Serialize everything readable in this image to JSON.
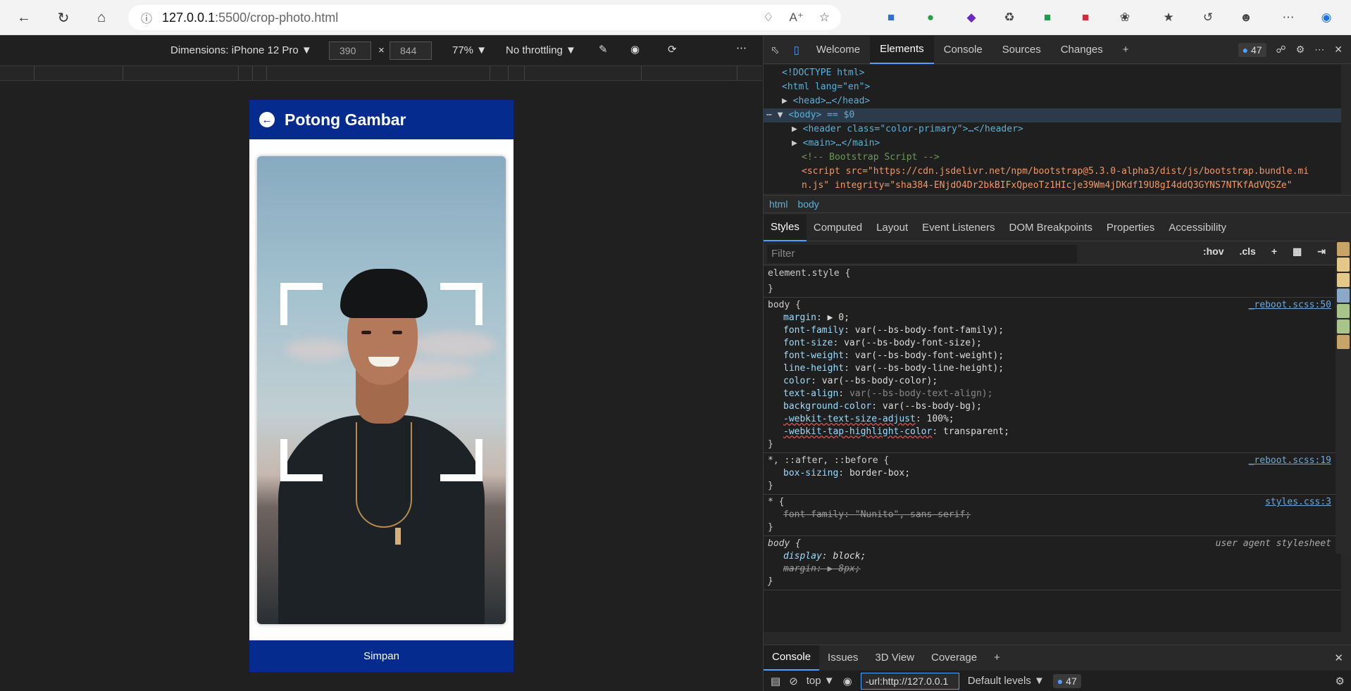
{
  "browser": {
    "url_host": "127.0.0.1",
    "url_path": ":5500/crop-photo.html"
  },
  "device_toolbar": {
    "dimensions_label": "Dimensions: iPhone 12 Pro",
    "width": "390",
    "height": "844",
    "zoom": "77%",
    "throttling": "No throttling"
  },
  "app": {
    "title": "Potong Gambar",
    "save_label": "Simpan"
  },
  "devtools": {
    "tabs": [
      "Welcome",
      "Elements",
      "Console",
      "Sources",
      "Changes"
    ],
    "issues_count": "47",
    "breadcrumbs": [
      "html",
      "body"
    ],
    "sub_tabs": [
      "Styles",
      "Computed",
      "Layout",
      "Event Listeners",
      "DOM Breakpoints",
      "Properties",
      "Accessibility"
    ],
    "filter_placeholder": "Filter",
    "hov": ":hov",
    "cls": ".cls",
    "dom_lines": [
      "<!DOCTYPE html>",
      "<html lang=\"en\">",
      "<head>…</head>",
      "<body> == $0",
      "<header class=\"color-primary\">…</header>",
      "<main>…</main>",
      "<!-- Bootstrap Script -->",
      "<script src=\"https://cdn.jsdelivr.net/npm/bootstrap@5.3.0-alpha3/dist/js/bootstrap.bundle.mi",
      "n.js\" integrity=\"sha384-ENjdO4Dr2bkBIFxQpeoTz1HIcje39Wm4jDKdf19U8gI4ddQ3GYNS7NTKfAdVQSZe\""
    ],
    "styles": {
      "element_style": "element.style {",
      "body_rule": {
        "selector": "body {",
        "source": "_reboot.scss:50",
        "props": [
          [
            "margin",
            "▶ 0;"
          ],
          [
            "font-family",
            "var(--bs-body-font-family);"
          ],
          [
            "font-size",
            "var(--bs-body-font-size);"
          ],
          [
            "font-weight",
            "var(--bs-body-font-weight);"
          ],
          [
            "line-height",
            "var(--bs-body-line-height);"
          ],
          [
            "color",
            "var(--bs-body-color);"
          ],
          [
            "text-align",
            "var(--bs-body-text-align);"
          ],
          [
            "background-color",
            "var(--bs-body-bg);"
          ],
          [
            "-webkit-text-size-adjust",
            "100%;"
          ],
          [
            "-webkit-tap-highlight-color",
            "transparent;"
          ]
        ]
      },
      "universal_rule": {
        "selector": "*, ::after, ::before {",
        "source": "_reboot.scss:19",
        "prop": [
          "box-sizing",
          "border-box;"
        ]
      },
      "star_rule": {
        "selector": "* {",
        "source": "styles.css:3",
        "prop": [
          "font-family",
          "\"Nunito\", sans-serif;"
        ]
      },
      "ua_rule": {
        "selector": "body {",
        "source": "user agent stylesheet",
        "props": [
          [
            "display",
            "block;"
          ],
          [
            "margin",
            "▶ 8px;"
          ]
        ]
      }
    },
    "console_tabs": [
      "Console",
      "Issues",
      "3D View",
      "Coverage"
    ],
    "context": "top",
    "console_filter": "-url:http://127.0.0.1",
    "levels": "Default levels",
    "console_count": "47"
  },
  "colors": {
    "primary": "#062b8e",
    "accent": "#4ea1ff"
  }
}
